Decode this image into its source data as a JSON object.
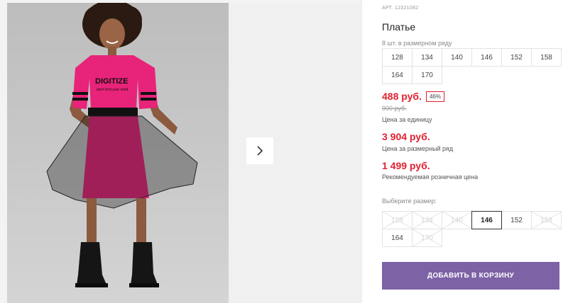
{
  "product": {
    "article": "АРТ. 12321082",
    "title": "Платье",
    "print_text": "DIGITIZE",
    "print_subtext": "don't limit your mind"
  },
  "pack": {
    "label": "8 шт. в размерном ряду",
    "sizes": [
      "128",
      "134",
      "140",
      "146",
      "152",
      "158",
      "164",
      "170"
    ]
  },
  "pricing": {
    "unit_price": "488 руб.",
    "discount": "46%",
    "old_price": "900 руб.",
    "unit_label": "Цена за единицу",
    "pack_price": "3 904 руб.",
    "pack_label": "Цена за размерный ряд",
    "retail_price": "1 499 руб.",
    "retail_label": "Рекомендуемая розничная цена"
  },
  "size_selector": {
    "label": "Выберите размер:",
    "options": [
      {
        "size": "128",
        "state": "disabled"
      },
      {
        "size": "134",
        "state": "disabled"
      },
      {
        "size": "140",
        "state": "disabled"
      },
      {
        "size": "146",
        "state": "selected"
      },
      {
        "size": "152",
        "state": "available"
      },
      {
        "size": "158",
        "state": "disabled"
      },
      {
        "size": "164",
        "state": "available"
      },
      {
        "size": "170",
        "state": "disabled"
      }
    ]
  },
  "actions": {
    "add_to_cart": "ДОБАВИТЬ В КОРЗИНУ"
  },
  "gallery": {
    "next_icon": "chevron-right-icon"
  },
  "colors": {
    "price": "#e0202f",
    "button": "#7d62a6",
    "dress": "#e8237a"
  }
}
